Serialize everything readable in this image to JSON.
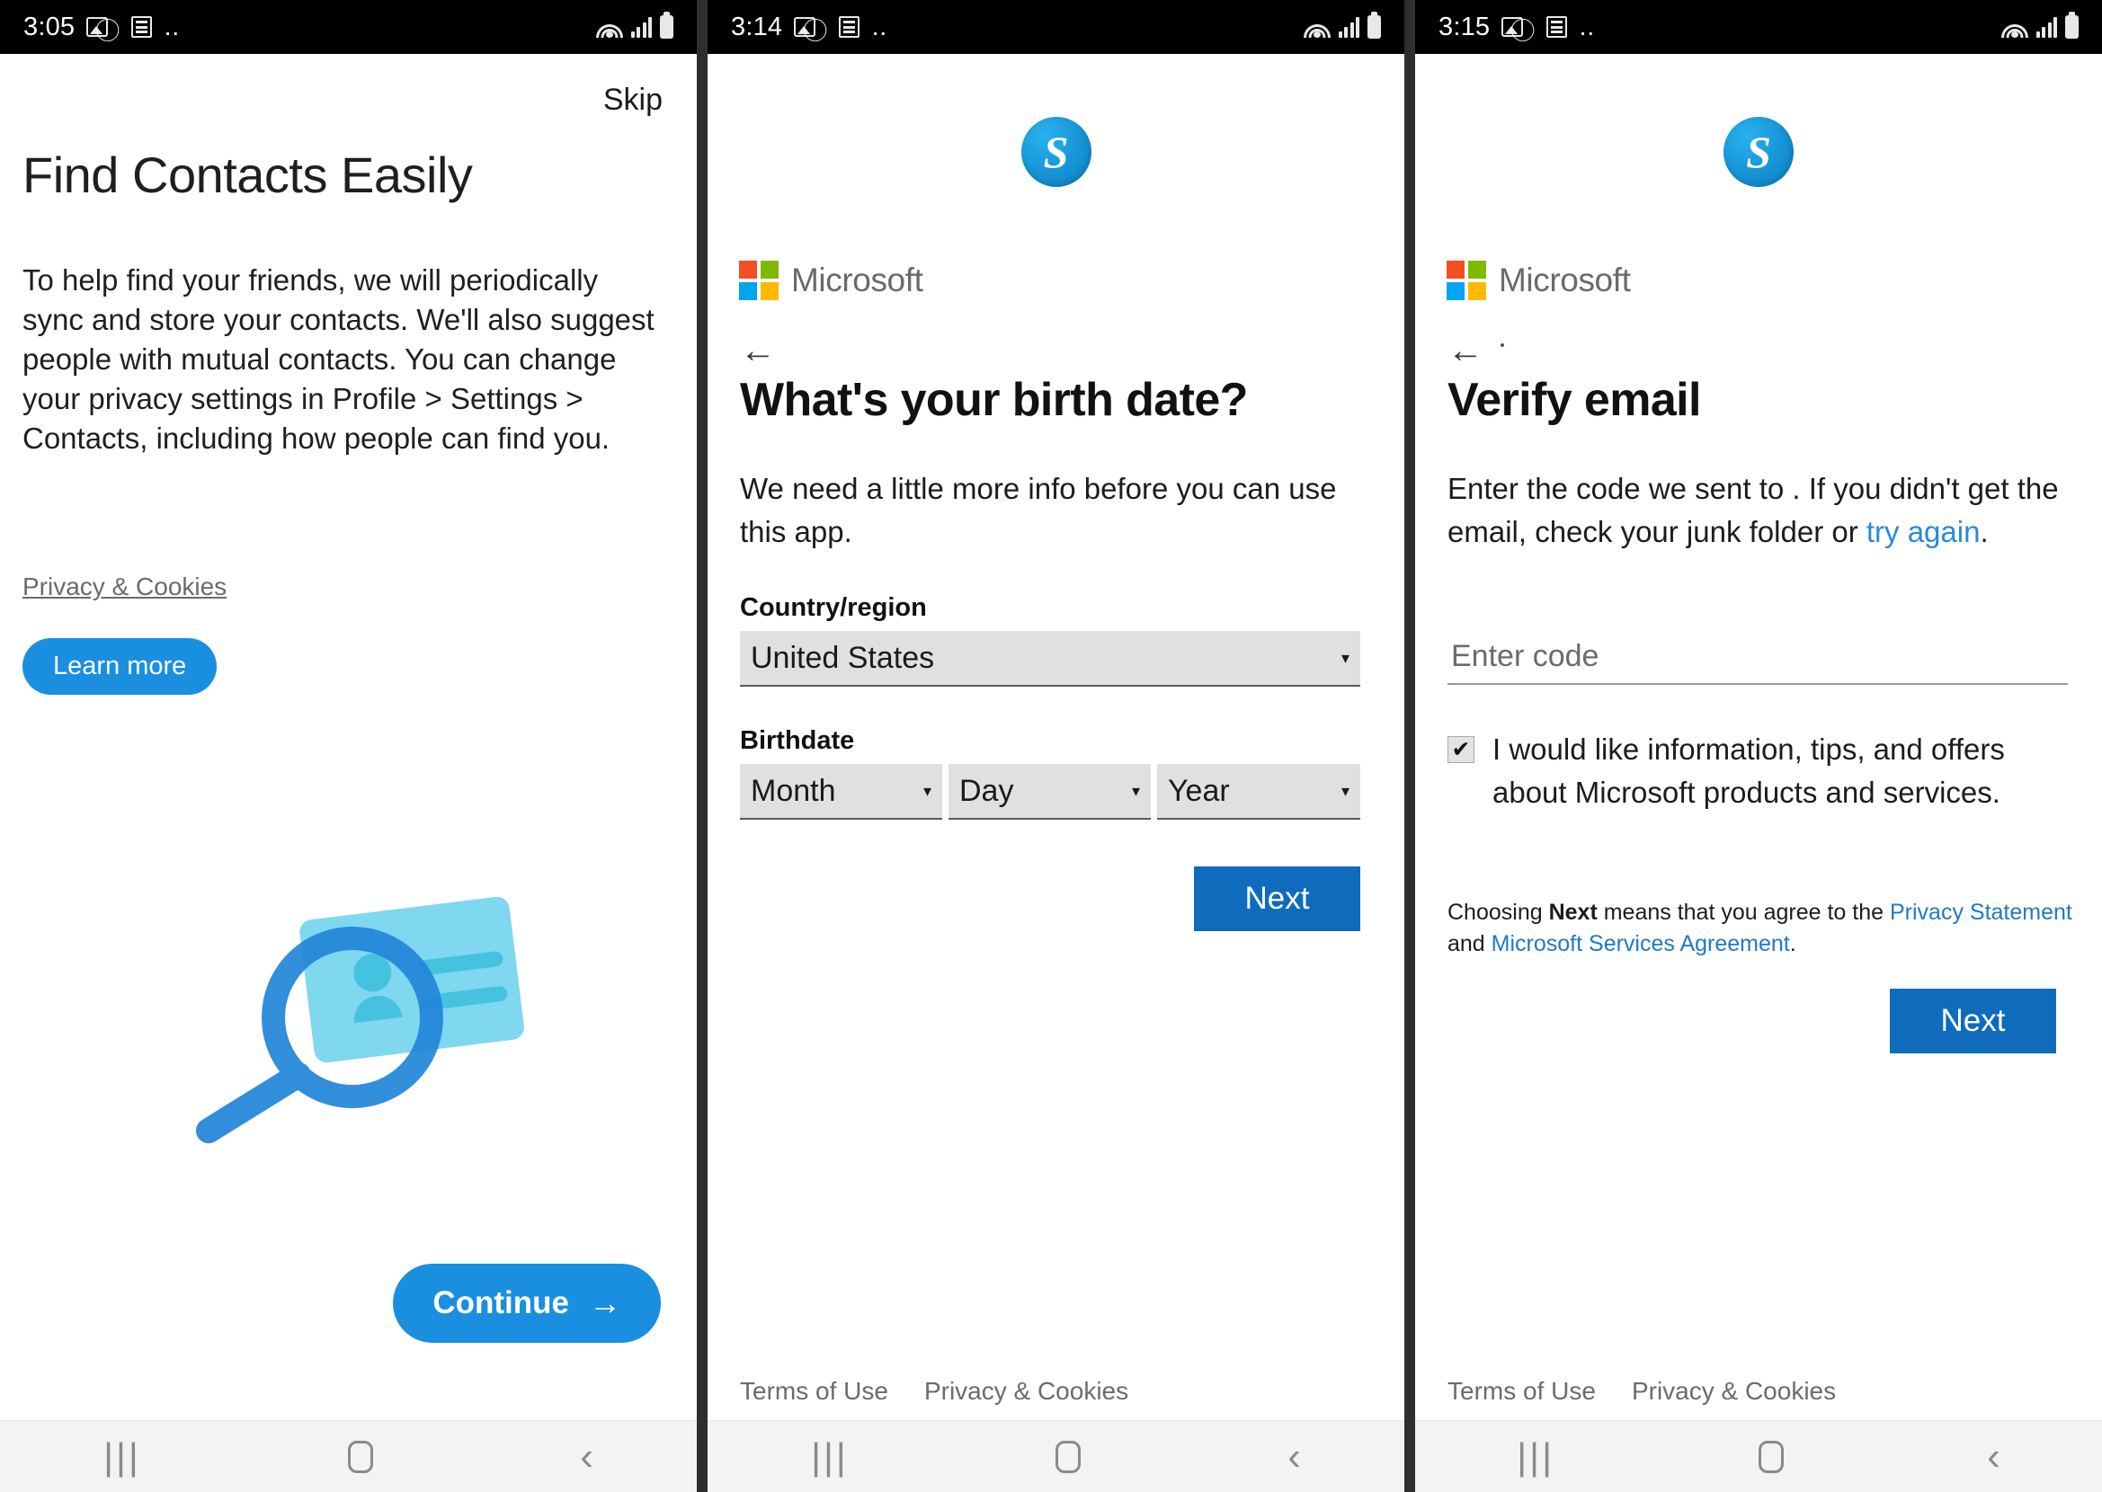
{
  "panels": [
    {
      "status": {
        "time": "3:05",
        "icons": [
          "photo-icon",
          "link-icon",
          "note-icon",
          "more-dots-icon",
          "wifi-icon",
          "signal-icon",
          "battery-icon"
        ]
      },
      "skip_label": "Skip",
      "title": "Find Contacts Easily",
      "description": "To help find your friends, we will periodically sync and store your contacts. We'll also suggest people with mutual contacts. You can change your privacy settings in Profile > Settings > Contacts, including how people can find you.",
      "privacy_link": "Privacy & Cookies",
      "learn_more_label": "Learn more",
      "continue_label": "Continue",
      "continue_arrow": "→",
      "illustration": "contacts-search-illustration"
    },
    {
      "status": {
        "time": "3:14"
      },
      "skype_logo_letter": "S",
      "microsoft_label": "Microsoft",
      "back_arrow": "←",
      "heading": "What's your birth date?",
      "subheading": "We need a little more info before you can use this app.",
      "country_label": "Country/region",
      "country_value": "United States",
      "birthdate_label": "Birthdate",
      "month_value": "Month",
      "day_value": "Day",
      "year_value": "Year",
      "caret": "▾",
      "next_label": "Next",
      "footer": {
        "terms": "Terms of Use",
        "privacy": "Privacy & Cookies"
      }
    },
    {
      "status": {
        "time": "3:15"
      },
      "skype_logo_letter": "S",
      "microsoft_label": "Microsoft",
      "back_arrow": "←",
      "heading": "Verify email",
      "body_part1": "Enter the code we sent to",
      "body_email": "",
      "body_part2": ". If you didn't get the email, check your junk folder or ",
      "try_again_link": "try again",
      "body_end": ".",
      "code_placeholder": "Enter code",
      "code_value": "",
      "checkbox_checked": true,
      "checkbox_mark": "✔",
      "checkbox_label": "I would like information, tips, and offers about Microsoft products and services.",
      "consent_pre": "Choosing ",
      "consent_next": "Next",
      "consent_mid": " means that you agree to the ",
      "consent_link1": "Privacy Statement",
      "consent_and": " and ",
      "consent_link2": "Microsoft Services Agreement",
      "consent_end": ".",
      "next_label": "Next",
      "footer": {
        "terms": "Terms of Use",
        "privacy": "Privacy & Cookies"
      }
    }
  ],
  "navbar": {
    "recents": "|||",
    "home": "home-icon",
    "back": "‹"
  },
  "colors": {
    "skype_blue": "#1a8fe0",
    "ms_button_blue": "#0f6cbd",
    "link_blue": "#2a8ad4",
    "status_bar_bg": "#000000",
    "navbar_bg": "#f3f3f3",
    "gap_bg": "#2f2f2f",
    "ms_red": "#f25022",
    "ms_green": "#7fba00",
    "ms_blue": "#00a4ef",
    "ms_yellow": "#ffb900"
  }
}
